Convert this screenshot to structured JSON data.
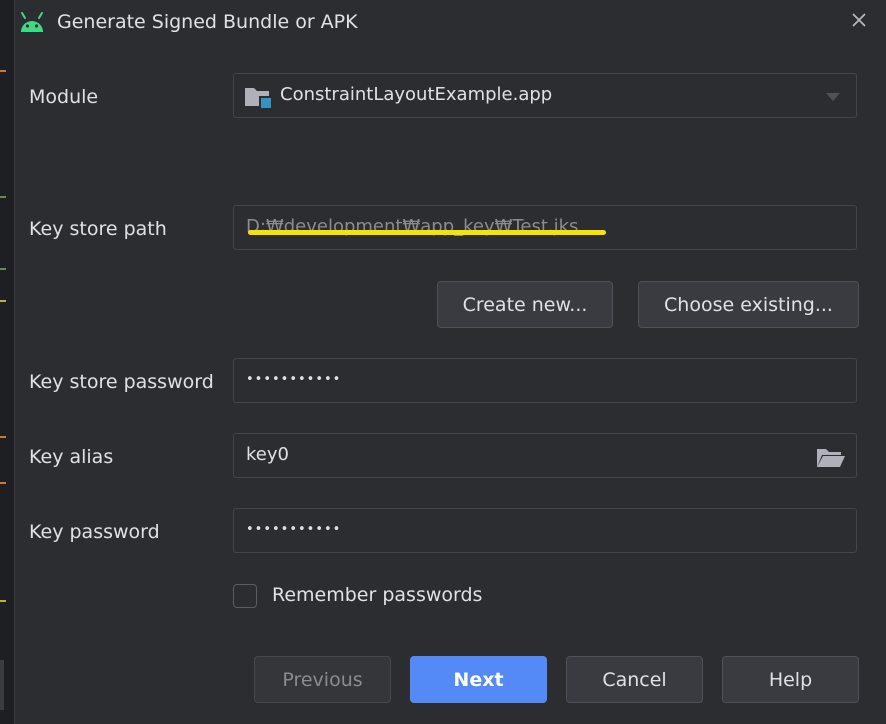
{
  "dialog": {
    "title": "Generate Signed Bundle or APK",
    "title_icon": "android-icon",
    "close_icon": "close-icon"
  },
  "form": {
    "module": {
      "label": "Module",
      "value": "ConstraintLayoutExample.app",
      "icon": "module-folder-icon"
    },
    "key_store_path": {
      "label": "Key store path",
      "value": "D:₩development₩app_key₩Test.jks"
    },
    "create_new_button": "Create new...",
    "choose_existing_button": "Choose existing...",
    "key_store_password": {
      "label": "Key store password",
      "value": "•••••••••••"
    },
    "key_alias": {
      "label": "Key alias",
      "value": "key0",
      "icon": "folder-open-icon"
    },
    "key_password": {
      "label": "Key password",
      "value": "•••••••••••"
    },
    "remember_passwords": {
      "label": "Remember passwords",
      "checked": false
    }
  },
  "footer": {
    "previous": "Previous",
    "next": "Next",
    "cancel": "Cancel",
    "help": "Help"
  },
  "colors": {
    "background": "#2b2d30",
    "primary_button": "#548af7",
    "android_green": "#3ddc84",
    "highlight": "#f5e400"
  }
}
